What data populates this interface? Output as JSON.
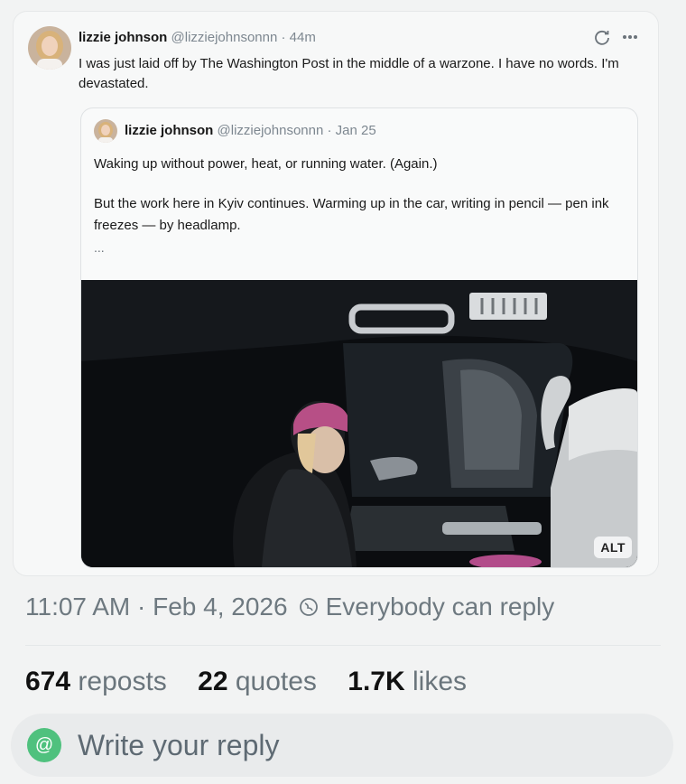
{
  "post": {
    "author_name": "lizzie johnson",
    "author_handle": "@lizziejohnsonnn",
    "separator": "·",
    "time": "44m",
    "text": "I was just laid off by The Washington Post in the middle of a warzone. I have no words. I'm devastated.",
    "icons": {
      "edit": "refresh-icon",
      "more": "more-icon"
    }
  },
  "quoted": {
    "author_name": "lizzie johnson",
    "author_handle": "@lizziejohnsonnn",
    "separator": "·",
    "date": "Jan 25",
    "line1": "Waking up without power, heat, or running water. (Again.)",
    "line2": "But the work here in Kyiv continues. Warming up in the car, writing in pencil — pen ink freezes — by headlamp.",
    "ellipsis": "...",
    "alt_badge": "ALT"
  },
  "meta": {
    "time": "11:07 AM",
    "separator": "·",
    "date": "Feb 4, 2026",
    "reply_setting": "Everybody can reply"
  },
  "stats": {
    "reposts_count": "674",
    "reposts_label": "reposts",
    "quotes_count": "22",
    "quotes_label": "quotes",
    "likes_count": "1.7K",
    "likes_label": "likes"
  },
  "reply": {
    "placeholder": "Write your reply",
    "avatar_symbol": "@"
  },
  "colors": {
    "accent_green": "#4fc17e",
    "muted": "#7d8790"
  }
}
